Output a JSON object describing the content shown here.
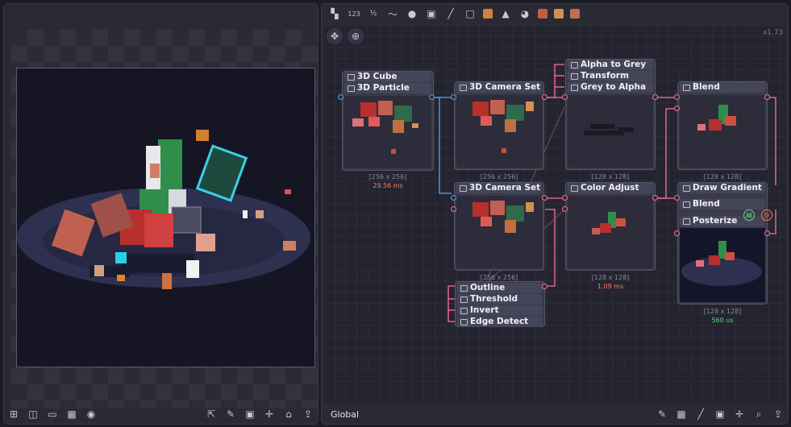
{
  "graph": {
    "zoom": "x1.73",
    "global_label": "Global",
    "toolbar_text": {
      "numbers": "123",
      "half": "½"
    }
  },
  "nodes": {
    "cube": {
      "title": "3D Cube"
    },
    "particle": {
      "title": "3D Particle",
      "size": "[256 x 256]",
      "time": "29.56 ms"
    },
    "camset1": {
      "title": "3D Camera Set",
      "size": "[256 x 256]"
    },
    "camset2": {
      "title": "3D Camera Set",
      "size": "[256 x 256]"
    },
    "alpha_to_grey": {
      "title": "Alpha to Grey"
    },
    "transform": {
      "title": "Transform"
    },
    "grey_to_alpha": {
      "title": "Grey to Alpha",
      "size": "[128 x 128]"
    },
    "color_adjust": {
      "title": "Color Adjust",
      "size": "[128 x 128]",
      "time": "1.09 ms"
    },
    "blend1": {
      "title": "Blend",
      "size": "[128 x 128]"
    },
    "draw_gradient": {
      "title": "Draw Gradient"
    },
    "blend2": {
      "title": "Blend"
    },
    "posterize": {
      "title": "Posterize",
      "size": "[128 x 128]",
      "time": "560 us"
    },
    "outline": {
      "title": "Outline"
    },
    "threshold": {
      "title": "Threshold"
    },
    "invert": {
      "title": "Invert"
    },
    "edge_detect": {
      "title": "Edge Detect"
    }
  },
  "icons": {
    "preview_bottom": [
      "add-icon",
      "split-icon",
      "frame-icon",
      "grid-icon",
      "palette-icon",
      "export-icon",
      "brush-icon",
      "layer-icon",
      "crosshair-icon",
      "lock-icon",
      "upload-icon"
    ],
    "graph_bottom": [
      "brush-icon",
      "grid-icon",
      "line-icon",
      "layer-icon",
      "crosshair-icon",
      "search-icon",
      "upload-icon"
    ]
  },
  "colors": {
    "accent_pink": "#ff6fa0",
    "accent_blue": "#4aa8ff",
    "time_orange": "#ff7a5a",
    "time_green": "#5adc7a"
  }
}
